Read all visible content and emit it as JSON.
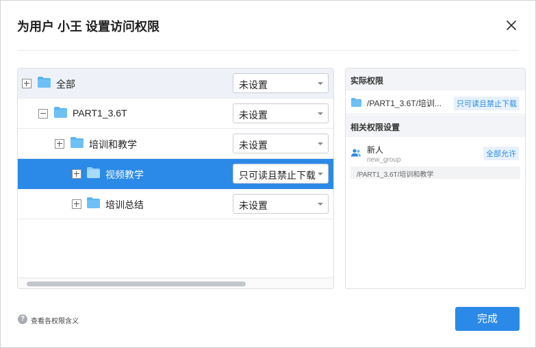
{
  "dialog": {
    "title": "为用户 小王 设置访问权限",
    "done_label": "完成",
    "help_link": "查看各权限含义",
    "help_glyph": "?"
  },
  "colors": {
    "accent": "#2b8ae8",
    "folder": "#5ab4f0",
    "header_row": "#eef2f8"
  },
  "tree": {
    "rows": [
      {
        "label": "全部",
        "permission": "未设置",
        "expander": "plus",
        "icon": "folder-icon",
        "selected": false
      },
      {
        "label": "PART1_3.6T",
        "permission": "未设置",
        "expander": "minus",
        "icon": "folder-icon",
        "selected": false
      },
      {
        "label": "培训和教学",
        "permission": "未设置",
        "expander": "plus",
        "icon": "folder-icon",
        "selected": false
      },
      {
        "label": "视频教学",
        "permission": "只可读且禁止下载",
        "expander": "plus",
        "icon": "folder-icon",
        "selected": true
      },
      {
        "label": "培训总结",
        "permission": "未设置",
        "expander": "plus",
        "icon": "folder-icon",
        "selected": false
      }
    ]
  },
  "side": {
    "effective": {
      "heading": "实际权限",
      "path": "/PART1_3.6T/培训...",
      "tag": "只可读且禁止下载"
    },
    "related": {
      "heading": "相关权限设置",
      "name": "新人",
      "group": "new_group",
      "tag": "全部允许",
      "path": "/PART1_3.6T/培训和教学"
    }
  }
}
